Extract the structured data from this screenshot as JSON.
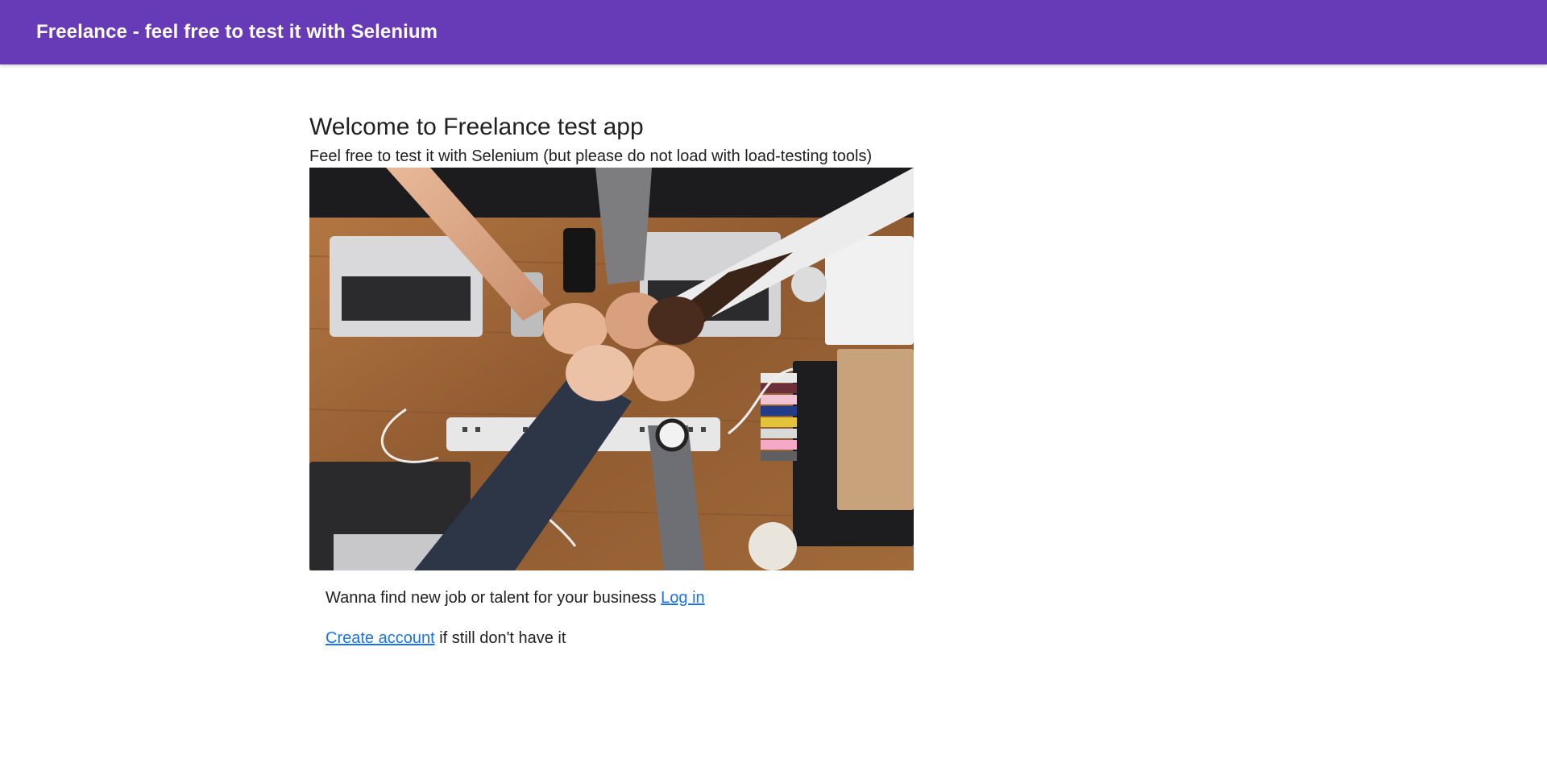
{
  "header": {
    "title": "Freelance - feel free to test it with Selenium",
    "bg_color": "#673ab7"
  },
  "main": {
    "heading": "Welcome to Freelance test app",
    "subtitle": "Feel free to test it with Selenium (but please do not load with load-testing tools)",
    "hero_image": {
      "description_name": "teamwork-fist-bump-photo"
    },
    "cta_line1": {
      "text": "Wanna find new job or talent for your business",
      "link_label": "Log in"
    },
    "cta_line2": {
      "link_label": "Create account",
      "text": "if still don't have it"
    },
    "link_color": "#1a73e8"
  }
}
